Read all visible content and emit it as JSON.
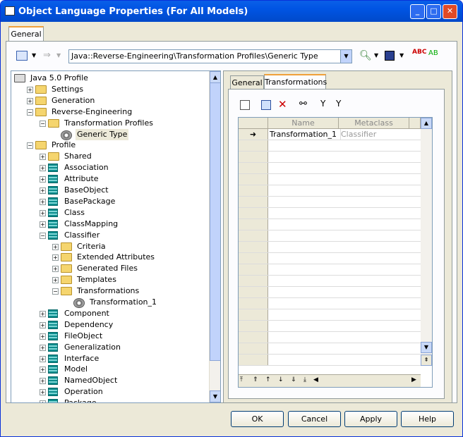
{
  "window": {
    "title": "Object Language Properties (For All Models)",
    "tab": "General"
  },
  "toolbar": {
    "path": "Java::Reverse-Engineering\\Transformation Profiles\\Generic  Type"
  },
  "tree": {
    "items": [
      {
        "label": "Java 5.0 Profile",
        "level": 0,
        "icon": "root-icon",
        "pm": ""
      },
      {
        "label": "Settings",
        "level": 1,
        "icon": "folder-icon",
        "pm": "+"
      },
      {
        "label": "Generation",
        "level": 1,
        "icon": "folder-icon",
        "pm": "+"
      },
      {
        "label": "Reverse-Engineering",
        "level": 1,
        "icon": "folder-icon",
        "pm": "-"
      },
      {
        "label": "Transformation Profiles",
        "level": 2,
        "icon": "folder-icon",
        "pm": "-"
      },
      {
        "label": "Generic  Type",
        "level": 3,
        "icon": "gear-icon",
        "pm": "",
        "selected": true
      },
      {
        "label": "Profile",
        "level": 1,
        "icon": "folder-icon",
        "pm": "-"
      },
      {
        "label": "Shared",
        "level": 2,
        "icon": "folder-icon",
        "pm": "+"
      },
      {
        "label": "Association",
        "level": 2,
        "icon": "class-icon",
        "pm": "+"
      },
      {
        "label": "Attribute",
        "level": 2,
        "icon": "class-icon",
        "pm": "+"
      },
      {
        "label": "BaseObject",
        "level": 2,
        "icon": "class-icon",
        "pm": "+"
      },
      {
        "label": "BasePackage",
        "level": 2,
        "icon": "class-icon",
        "pm": "+"
      },
      {
        "label": "Class",
        "level": 2,
        "icon": "class-icon",
        "pm": "+"
      },
      {
        "label": "ClassMapping",
        "level": 2,
        "icon": "class-icon",
        "pm": "+"
      },
      {
        "label": "Classifier",
        "level": 2,
        "icon": "class-icon",
        "pm": "-"
      },
      {
        "label": "Criteria",
        "level": 3,
        "icon": "folder-icon",
        "pm": "+"
      },
      {
        "label": "Extended Attributes",
        "level": 3,
        "icon": "folder-icon",
        "pm": "+"
      },
      {
        "label": "Generated Files",
        "level": 3,
        "icon": "folder-icon",
        "pm": "+"
      },
      {
        "label": "Templates",
        "level": 3,
        "icon": "folder-icon",
        "pm": "+"
      },
      {
        "label": "Transformations",
        "level": 3,
        "icon": "folder-icon",
        "pm": "-"
      },
      {
        "label": "Transformation_1",
        "level": 4,
        "icon": "gear-icon",
        "pm": ""
      },
      {
        "label": "Component",
        "level": 2,
        "icon": "class-icon",
        "pm": "+"
      },
      {
        "label": "Dependency",
        "level": 2,
        "icon": "class-icon",
        "pm": "+"
      },
      {
        "label": "FileObject",
        "level": 2,
        "icon": "class-icon",
        "pm": "+"
      },
      {
        "label": "Generalization",
        "level": 2,
        "icon": "class-icon",
        "pm": "+"
      },
      {
        "label": "Interface",
        "level": 2,
        "icon": "class-icon",
        "pm": "+"
      },
      {
        "label": "Model",
        "level": 2,
        "icon": "class-icon",
        "pm": "+"
      },
      {
        "label": "NamedObject",
        "level": 2,
        "icon": "class-icon",
        "pm": "+"
      },
      {
        "label": "Operation",
        "level": 2,
        "icon": "class-icon",
        "pm": "+"
      },
      {
        "label": "Package",
        "level": 2,
        "icon": "class-icon",
        "pm": "+"
      }
    ]
  },
  "right": {
    "tabs": [
      "General",
      "Transformations"
    ],
    "grid": {
      "headers": [
        "Name",
        "Metaclass"
      ],
      "rows": [
        {
          "marker": "➜",
          "name": "Transformation_1",
          "metaclass": "Classifier"
        }
      ]
    }
  },
  "buttons": {
    "ok": "OK",
    "cancel": "Cancel",
    "apply": "Apply",
    "help": "Help"
  }
}
